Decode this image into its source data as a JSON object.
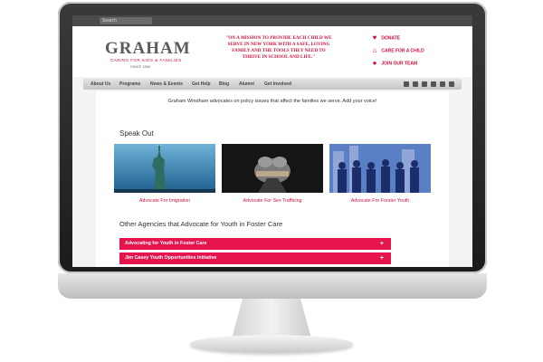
{
  "search": {
    "placeholder": "Search"
  },
  "brand": {
    "logo": "GRAHAM",
    "tagline": "CARING FOR KIDS & FAMILIES",
    "since": "SINCE 1806",
    "mission": "\"ON A MISSION TO PROVIDE EACH CHILD WE SERVE IN NEW YORK WITH A SAFE, LOVING FAMILY AND THE TOOLS THEY NEED TO THRIVE IN SCHOOL AND LIFE.\""
  },
  "cta": [
    {
      "icon": "heart-icon",
      "label": "DONATE"
    },
    {
      "icon": "house-icon",
      "label": "CARE FOR A CHILD"
    },
    {
      "icon": "person-icon",
      "label": "JOIN OUR TEAM"
    }
  ],
  "nav": [
    "About Us",
    "Programs",
    "News & Events",
    "Get Help",
    "Blog",
    "Alumni",
    "Get Involved"
  ],
  "social_icons": [
    "facebook-icon",
    "twitter-icon",
    "flickr-icon",
    "youtube-icon",
    "email-icon",
    "rss-icon"
  ],
  "main": {
    "intro": "Graham Windham advocates on policy issues that affect the families we serve. Add your voice!",
    "section_title": "Speak Out",
    "cards": [
      {
        "caption": "Advocate For Imigration",
        "image": "statue-of-liberty"
      },
      {
        "caption": "Advocate For Sex Trafficing",
        "image": "bound-hands"
      },
      {
        "caption": "Advocate For Forster Youth",
        "image": "people-silhouettes"
      }
    ],
    "agencies_title": "Other Agencies that Advocate for Youth in Foster Care",
    "accordion": [
      {
        "label": "Advocating for Youth in Foster Care",
        "symbol": "+"
      },
      {
        "label": "Jim Casey Youth Opportunities Initiative",
        "symbol": "+"
      }
    ]
  },
  "colors": {
    "accent": "#e5144c",
    "brand_red": "#d0103a",
    "bezel": "#2a2a2a"
  }
}
